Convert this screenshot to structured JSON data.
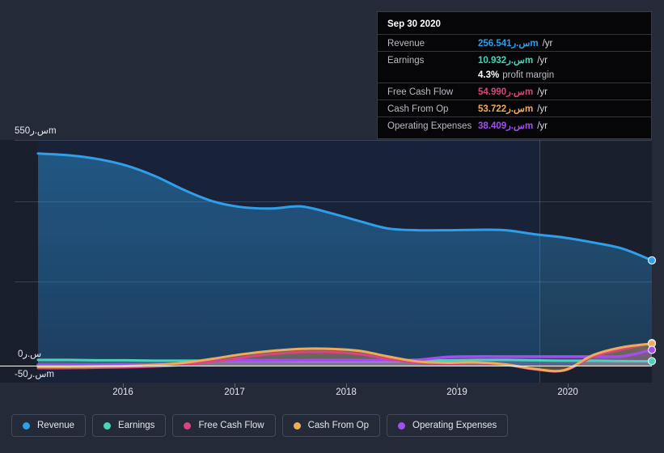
{
  "chart_data": {
    "type": "area",
    "title": "",
    "xlabel": "",
    "ylabel": "",
    "currency_suffix": "س.رm",
    "ylim": [
      -50,
      550
    ],
    "y_ticks": [
      {
        "value": 550,
        "label": "550س.رm"
      },
      {
        "value": 0,
        "label": "0س.ر"
      },
      {
        "value": -50,
        "label": "-50س.رm"
      }
    ],
    "grid": true,
    "legend_position": "bottom",
    "x_ticks": [
      "2016",
      "2017",
      "2018",
      "2019",
      "2020"
    ],
    "x": [
      "2015-06",
      "2015-09",
      "2015-12",
      "2016-03",
      "2016-06",
      "2016-09",
      "2016-12",
      "2017-03",
      "2017-06",
      "2017-09",
      "2017-12",
      "2018-03",
      "2018-06",
      "2018-09",
      "2018-12",
      "2019-03",
      "2019-06",
      "2019-09",
      "2019-12",
      "2020-03",
      "2020-06",
      "2020-09"
    ],
    "series": [
      {
        "name": "Revenue",
        "color": "#2e9fe8",
        "values": [
          517,
          513,
          504,
          488,
          462,
          428,
          400,
          386,
          383,
          388,
          372,
          352,
          334,
          330,
          330,
          331,
          330,
          320,
          312,
          300,
          285,
          256.541
        ]
      },
      {
        "name": "Earnings",
        "color": "#4ad3b8",
        "values": [
          14,
          14,
          13,
          13,
          12,
          12,
          12,
          12,
          12,
          11,
          11,
          11,
          11,
          12,
          13,
          14,
          14,
          13,
          12,
          12,
          11,
          10.932
        ]
      },
      {
        "name": "Free Cash Flow",
        "color": "#d9457e",
        "values": [
          -6,
          -6,
          -5,
          -4,
          -2,
          2,
          10,
          20,
          28,
          33,
          33,
          28,
          16,
          7,
          5,
          6,
          2,
          -9,
          -12,
          22,
          40,
          54.99
        ]
      },
      {
        "name": "Cash From Op",
        "color": "#eeac5a",
        "values": [
          -3,
          -3,
          -2,
          -1,
          2,
          7,
          17,
          28,
          36,
          41,
          41,
          36,
          22,
          10,
          7,
          8,
          3,
          -8,
          -11,
          26,
          45,
          53.722
        ]
      },
      {
        "name": "Operating Expenses",
        "color": "#a44ef0",
        "values": [
          2,
          2,
          2,
          3,
          3,
          5,
          12,
          13,
          13,
          13,
          13,
          13,
          13,
          14,
          21,
          22,
          22,
          22,
          22,
          22,
          23,
          38.409
        ]
      }
    ]
  },
  "y_axis": {
    "top_label": "550س.رm",
    "zero_label": "0س.ر",
    "bottom_label": "-50س.رm"
  },
  "x_axis": {
    "labels": [
      "2016",
      "2017",
      "2018",
      "2019",
      "2020"
    ]
  },
  "tooltip": {
    "date": "Sep 30 2020",
    "rows": [
      {
        "label": "Revenue",
        "value": "256.541س.رm",
        "unit": "/yr",
        "color": "#2e9fe8"
      },
      {
        "label": "Earnings",
        "value": "10.932س.رm",
        "unit": "/yr",
        "color": "#4ad3b8",
        "sub_value": "4.3%",
        "sub_text": "profit margin"
      },
      {
        "label": "Free Cash Flow",
        "value": "54.990س.رm",
        "unit": "/yr",
        "color": "#d9457e"
      },
      {
        "label": "Cash From Op",
        "value": "53.722س.رm",
        "unit": "/yr",
        "color": "#eeac5a"
      },
      {
        "label": "Operating Expenses",
        "value": "38.409س.رm",
        "unit": "/yr",
        "color": "#a44ef0"
      }
    ]
  },
  "legend": {
    "items": [
      {
        "label": "Revenue",
        "color": "#2e9fe8"
      },
      {
        "label": "Earnings",
        "color": "#4ad3b8"
      },
      {
        "label": "Free Cash Flow",
        "color": "#d9457e"
      },
      {
        "label": "Cash From Op",
        "color": "#eeac5a"
      },
      {
        "label": "Operating Expenses",
        "color": "#a44ef0"
      }
    ]
  },
  "colors": {
    "page_background": "#252a38",
    "plot_background": "#1b2030",
    "band_dark": "#1a1f2d",
    "band_blue": "#18233a",
    "zero_line": "#ffffff",
    "gridline": "rgba(170,180,200,0.22)",
    "tooltip_background": "#060608",
    "tooltip_border": "#3a3a42"
  }
}
